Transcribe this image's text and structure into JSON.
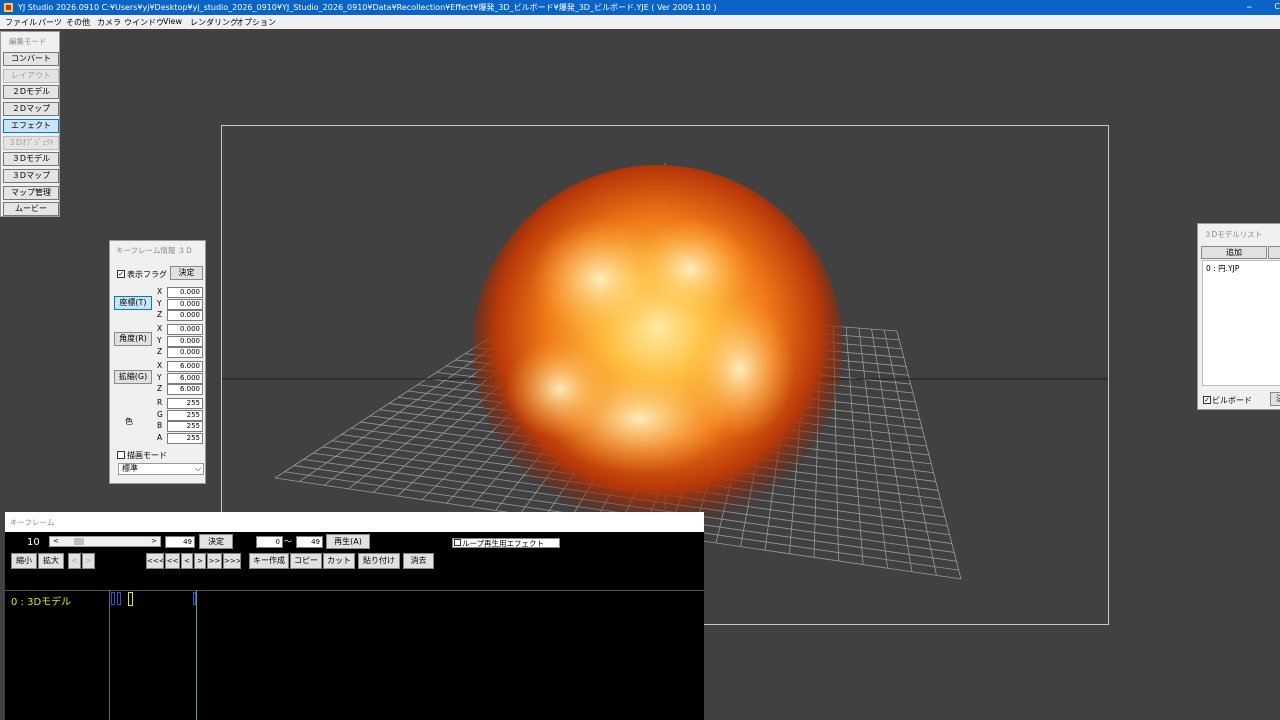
{
  "window": {
    "title": "YJ Studio 2026.0910   C:¥Users¥yj¥Desktop¥yj_studio_2026_0910¥YJ_Studio_2026_0910¥Data¥Recollection¥Effect¥爆発_3D_ビルボード¥爆発_3D_ビルボード.YJE ( Ver 2009.110 )",
    "minimize": "–",
    "cut_glyph": "C"
  },
  "menu": [
    "ファイル",
    "パーツ",
    "その他",
    "カメラ",
    "ウインドウ",
    "View",
    "レンダリング",
    "オプション"
  ],
  "mode_panel": {
    "title": "編集モード",
    "buttons": [
      {
        "label": "コンバート",
        "state": "normal"
      },
      {
        "label": "レイアウト",
        "state": "disabled"
      },
      {
        "label": "２Dモデル",
        "state": "normal"
      },
      {
        "label": "２Dマップ",
        "state": "normal"
      },
      {
        "label": "エフェクト",
        "state": "active"
      },
      {
        "label": "３Dｵﾌﾞｼﾞｪｸﾄ",
        "state": "disabled"
      },
      {
        "label": "３Dモデル",
        "state": "normal"
      },
      {
        "label": "３Dマップ",
        "state": "normal"
      },
      {
        "label": "マップ管理",
        "state": "normal"
      },
      {
        "label": "ムービー",
        "state": "normal"
      }
    ]
  },
  "keyframe_panel": {
    "title": "キーフレーム情報 ３Ｄ",
    "display_flag": "表示フラグ",
    "decide": "決定",
    "position": "座標(T)",
    "rotation": "角度(R)",
    "scale": "拡縮(G)",
    "color": "色",
    "axes": [
      "X",
      "Y",
      "Z"
    ],
    "rgba": [
      "R",
      "G",
      "B",
      "A"
    ],
    "position_values": [
      "0.000",
      "0.000",
      "0.000"
    ],
    "rotation_values": [
      "0.000",
      "0.000",
      "0.000"
    ],
    "scale_values": [
      "6.000",
      "6.000",
      "6.000"
    ],
    "color_values": [
      "255",
      "255",
      "255",
      "255"
    ],
    "draw_mode": "描画モード",
    "blend": "標準"
  },
  "model_list": {
    "title": "３Dモデルリスト",
    "add": "追加",
    "items": [
      "0 : 円.YJP"
    ],
    "billboard": "ビルボード",
    "cut_button": "決"
  },
  "timeline": {
    "title": "キーフレーム",
    "current_frame": "10",
    "scroll_left": "<",
    "scroll_right": ">",
    "max_frame": "49",
    "decide": "決定",
    "range_start": "0",
    "tilde": "〜",
    "range_end": "49",
    "play": "再生(A)",
    "loop_effect": "ループ再生用エフェクト",
    "shrink": "縮小",
    "expand": "拡大",
    "nav_left": "<",
    "nav_right": ">",
    "step_buttons": [
      "<<<",
      "<<",
      "<",
      ">",
      ">>",
      ">>>"
    ],
    "key_create": "キー作成",
    "copy": "コピー",
    "cut": "カット",
    "paste": "貼り付け",
    "erase": "消去",
    "track": "0 : 3Dモデル"
  },
  "colors": {
    "titlebar": "#0a64c8",
    "viewport": "#414141",
    "active_mode": "#cce4f7",
    "track_text": "#e8e800"
  }
}
